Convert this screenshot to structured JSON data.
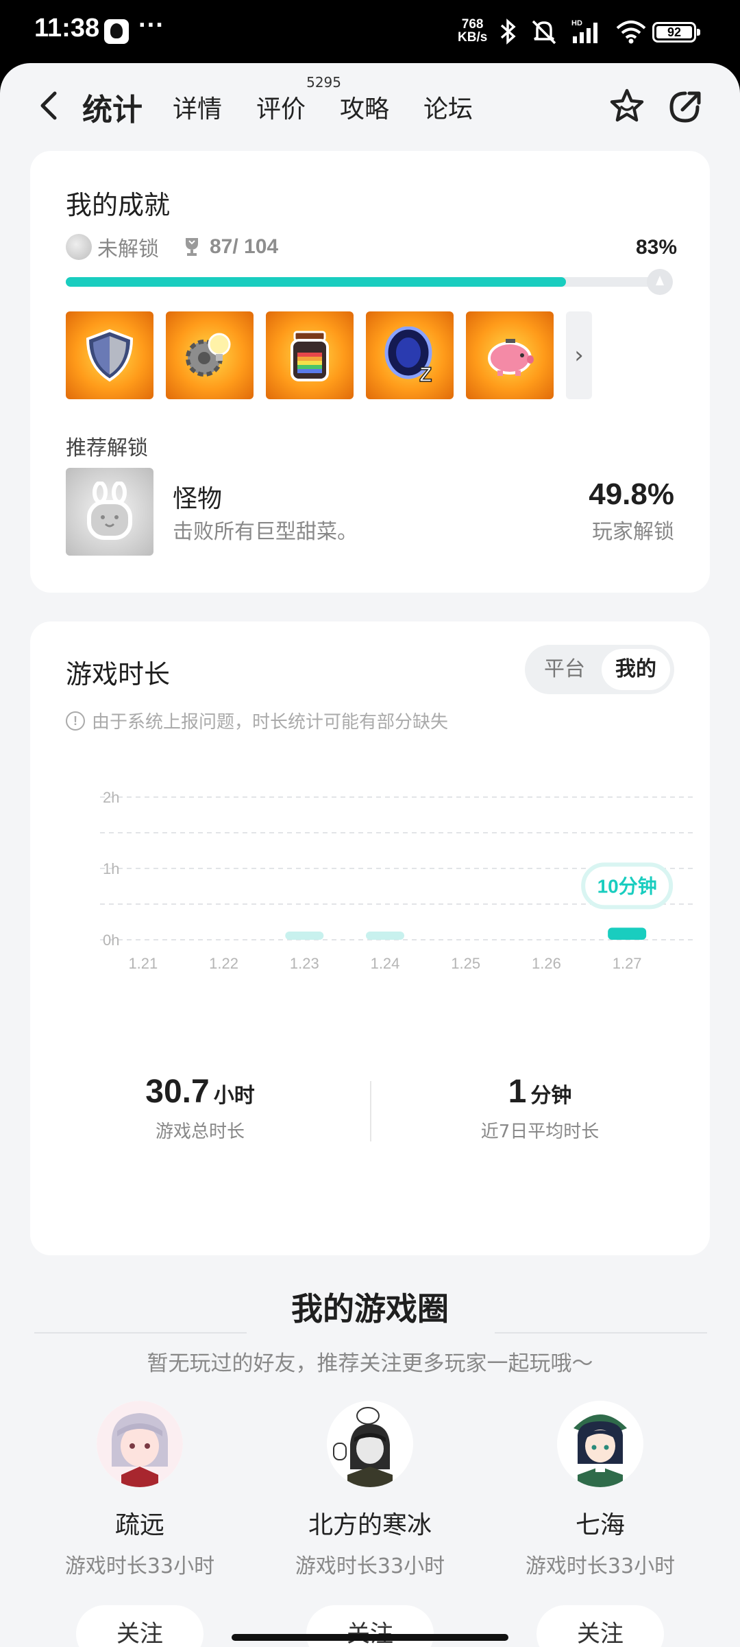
{
  "status_bar": {
    "time": "11:38",
    "more": "···",
    "net_speed_value": "768",
    "net_speed_unit": "KB/s",
    "battery": "92"
  },
  "nav": {
    "tabs": [
      {
        "label": "统计",
        "active": true
      },
      {
        "label": "详情"
      },
      {
        "label": "评价",
        "badge": "5295"
      },
      {
        "label": "攻略"
      },
      {
        "label": "论坛"
      }
    ]
  },
  "achievements": {
    "title": "我的成就",
    "locked_label": "未解锁",
    "count": "87/ 104",
    "percent_text": "83%",
    "progress": 0.83,
    "badges": [
      "shield-badge",
      "idea-gear-badge",
      "rainbow-jar-badge",
      "portal-sleep-badge",
      "piggy-bank-badge"
    ],
    "recommend_label": "推荐解锁",
    "recommend": {
      "name": "怪物",
      "desc": "击败所有巨型甜菜。",
      "percent": "49.8%",
      "percent_label": "玩家解锁"
    }
  },
  "playtime": {
    "title": "游戏时长",
    "toggle": {
      "off": "平台",
      "on": "我的"
    },
    "note": "由于系统上报问题，时长统计可能有部分缺失",
    "note_icon": "!",
    "total_value": "30.7",
    "total_unit": "小时",
    "total_label": "游戏总时长",
    "avg_value": "1",
    "avg_unit": "分钟",
    "avg_label": "近7日平均时长"
  },
  "chart_data": {
    "type": "bar",
    "categories": [
      "1.21",
      "1.22",
      "1.23",
      "1.24",
      "1.25",
      "1.26",
      "1.27"
    ],
    "values": [
      0,
      0,
      0.02,
      0.02,
      0,
      0,
      0.17
    ],
    "unit": "h",
    "y_ticks": [
      "0h",
      "1h",
      "2h"
    ],
    "ylim": [
      0,
      2
    ],
    "highlight_index": 6,
    "highlight_label": "10分钟",
    "colors": {
      "bar": "#c8f1ee",
      "highlight": "#19cdbf"
    }
  },
  "circle": {
    "title": "我的游戏圈",
    "subtitle": "暂无玩过的好友，推荐关注更多玩家一起玩哦～",
    "friends": [
      {
        "name": "疏远",
        "time": "游戏时长33小时",
        "follow": "关注"
      },
      {
        "name": "北方的寒冰",
        "time": "游戏时长33小时",
        "follow": "关注"
      },
      {
        "name": "七海",
        "time": "游戏时长33小时",
        "follow": "关注"
      }
    ]
  },
  "colors": {
    "accent": "#19cdbf",
    "background": "#f4f5f7",
    "card": "#ffffff"
  }
}
